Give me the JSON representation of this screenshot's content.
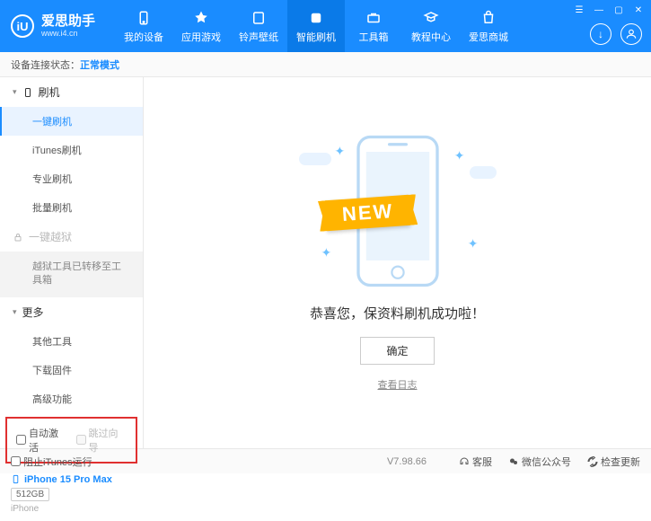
{
  "header": {
    "logo_letter": "iU",
    "app_name": "爱思助手",
    "app_url": "www.i4.cn",
    "nav": [
      {
        "label": "我的设备"
      },
      {
        "label": "应用游戏"
      },
      {
        "label": "铃声壁纸"
      },
      {
        "label": "智能刷机"
      },
      {
        "label": "工具箱"
      },
      {
        "label": "教程中心"
      },
      {
        "label": "爱思商城"
      }
    ]
  },
  "status": {
    "label": "设备连接状态：",
    "value": "正常模式"
  },
  "sidebar": {
    "group_flash": "刷机",
    "items_flash": [
      "一键刷机",
      "iTunes刷机",
      "专业刷机",
      "批量刷机"
    ],
    "group_jailbreak": "一键越狱",
    "jailbreak_note": "越狱工具已转移至工具箱",
    "group_more": "更多",
    "items_more": [
      "其他工具",
      "下载固件",
      "高级功能"
    ],
    "checkbox_auto": "自动激活",
    "checkbox_skip": "跳过向导"
  },
  "device": {
    "name": "iPhone 15 Pro Max",
    "storage": "512GB",
    "type": "iPhone"
  },
  "main": {
    "banner": "NEW",
    "success": "恭喜您，保资料刷机成功啦！",
    "ok": "确定",
    "log_link": "查看日志"
  },
  "footer": {
    "block_itunes": "阻止iTunes运行",
    "version": "V7.98.66",
    "service": "客服",
    "wechat": "微信公众号",
    "update": "检查更新"
  }
}
